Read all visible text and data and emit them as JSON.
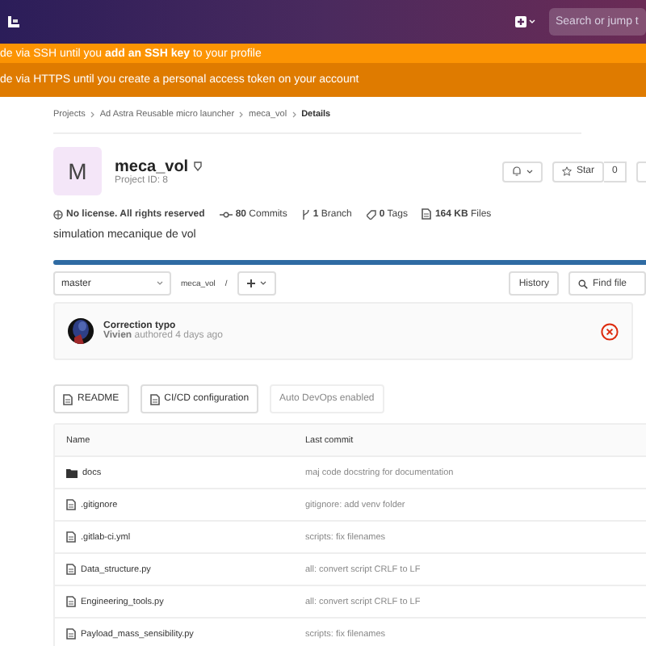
{
  "header": {
    "search": {
      "placeholder": "Search or jump t"
    }
  },
  "alerts": [
    {
      "kind": "warning",
      "text": "de via SSH until you **add an SSH key** to your profile"
    },
    {
      "kind": "danger",
      "text": "de via HTTPS until you create a personal access token on your account"
    }
  ],
  "breadcrumbs": [
    {
      "label": "Projects",
      "current": false
    },
    {
      "label": "Ad Astra Reusable micro launcher",
      "current": false
    },
    {
      "label": "meca_vol",
      "current": false
    },
    {
      "label": "Details",
      "current": true
    }
  ],
  "project": {
    "avatar_letter": "M",
    "name": "meca_vol",
    "id_label": "Project ID: 8",
    "star_label": "Star",
    "star_count": "0"
  },
  "stats": [
    {
      "kind": "license",
      "text": "No license. All rights reserved"
    },
    {
      "kind": "commits",
      "value": "80",
      "label": "Commits"
    },
    {
      "kind": "branch",
      "value": "1",
      "label": "Branch"
    },
    {
      "kind": "tags",
      "value": "0",
      "label": "Tags"
    },
    {
      "kind": "files",
      "value": "164 KB",
      "label": "Files"
    }
  ],
  "description": "simulation mecanique de vol",
  "language_bar": {
    "level": 1
  },
  "toolbar": {
    "branch": "master",
    "path": "meca_vol",
    "separator": "/",
    "buttons": [
      "History",
      "Find file"
    ]
  },
  "commit": {
    "title": "Correction typo",
    "author": "Vivien",
    "meta": "authored 4 days ago",
    "pipeline_failed": true
  },
  "quick_links": [
    {
      "kind": "file",
      "label": "README"
    },
    {
      "kind": "file",
      "label": "CI/CD configuration"
    },
    {
      "kind": "plain",
      "label": "Auto DevOps enabled"
    }
  ],
  "table": {
    "columns": [
      "Name",
      "Last commit"
    ],
    "rows": [
      {
        "kind": "folder",
        "name": "docs",
        "last_commit": "maj code docstring for documentation"
      },
      {
        "kind": "file",
        "name": ".gitignore",
        "last_commit": "gitignore: add venv folder"
      },
      {
        "kind": "file",
        "name": ".gitlab-ci.yml",
        "last_commit": "scripts: fix filenames"
      },
      {
        "kind": "file",
        "name": "Data_structure.py",
        "last_commit": "all: convert script CRLF to LF"
      },
      {
        "kind": "file",
        "name": "Engineering_tools.py",
        "last_commit": "all: convert script CRLF to LF"
      },
      {
        "kind": "file",
        "name": "Payload_mass_sensibility.py",
        "last_commit": "scripts: fix filenames"
      }
    ]
  }
}
